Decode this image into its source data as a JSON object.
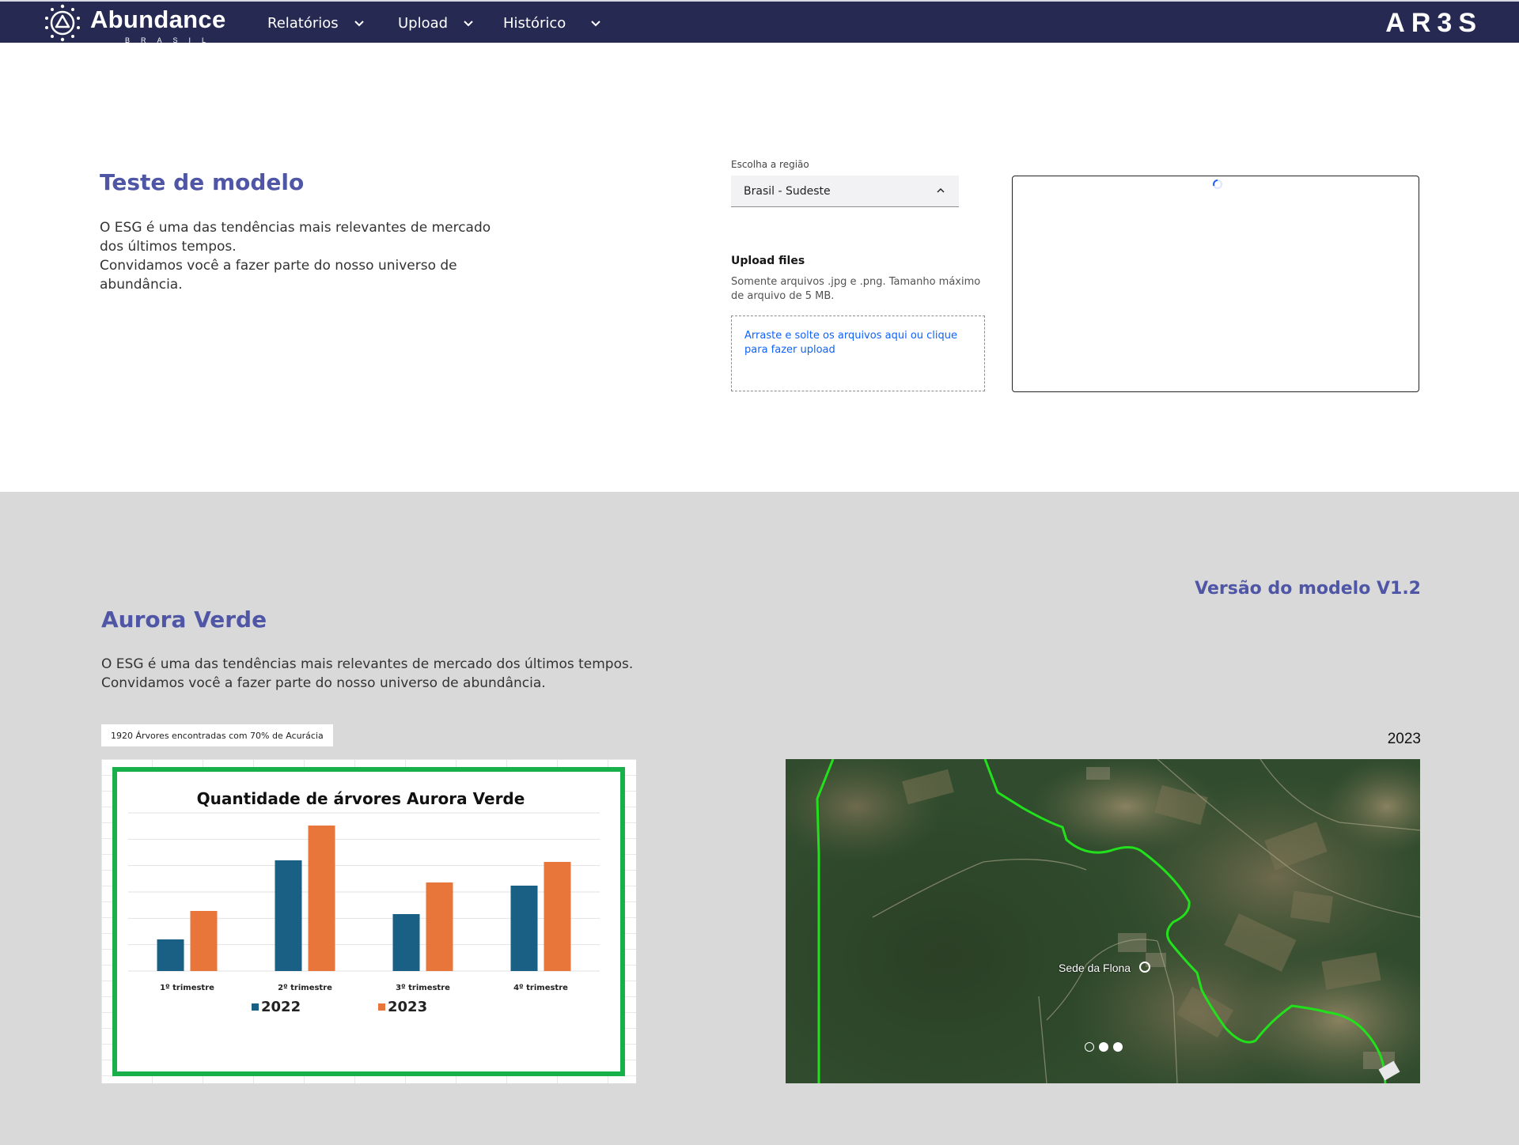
{
  "header": {
    "brand_name": "Abundance",
    "brand_sub": "BRASIL",
    "nav": [
      {
        "label": "Relatórios"
      },
      {
        "label": "Upload"
      },
      {
        "label": "Histórico"
      }
    ],
    "right_logo": "AR3S",
    "bg_color": "#262a52"
  },
  "teste": {
    "title": "Teste de modelo",
    "desc_line1": "O ESG é uma das tendências mais relevantes de mercado",
    "desc_line2": "dos últimos tempos.",
    "desc_line3": "Convidamos você a fazer parte do nosso universo de",
    "desc_line4": "abundância."
  },
  "region": {
    "label": "Escolha a região",
    "selected": "Brasil - Sudeste"
  },
  "upload": {
    "title": "Upload files",
    "help": "Somente arquivos .jpg e .png. Tamanho máximo de arquivo de 5 MB.",
    "dropzone": "Arraste e solte os arquivos aqui ou clique para fazer upload"
  },
  "aurora": {
    "title": "Aurora Verde",
    "desc_line1": "O ESG é uma das tendências mais relevantes de mercado dos últimos tempos.",
    "desc_line2": "Convidamos você a fazer parte do nosso universo de abundância.",
    "versao": "Versão do modelo V1.2",
    "badge": "1920 Árvores encontradas com 70% de Acurácia",
    "year": "2023"
  },
  "map": {
    "place_label": "Sede da Flona",
    "carousel_dots": 3,
    "active_dot": 0
  },
  "colors": {
    "accent_title": "#4f56a6",
    "series_2022": "#1a5f84",
    "series_2023": "#e8763a",
    "chart_frame": "#17b04a",
    "boundary_line": "#22e01c",
    "bottom_bg": "#d9d9d9"
  },
  "chart_data": {
    "type": "bar",
    "title": "Quantidade de árvores Aurora Verde",
    "categories": [
      "1º trimestre",
      "2º trimestre",
      "3º trimestre",
      "4º trimestre"
    ],
    "series": [
      {
        "name": "2022",
        "values": [
          20,
          70,
          36,
          54
        ]
      },
      {
        "name": "2023",
        "values": [
          38,
          92,
          56,
          69
        ]
      }
    ],
    "ylim": [
      0,
      100
    ],
    "grid": true,
    "legend": "bottom"
  }
}
